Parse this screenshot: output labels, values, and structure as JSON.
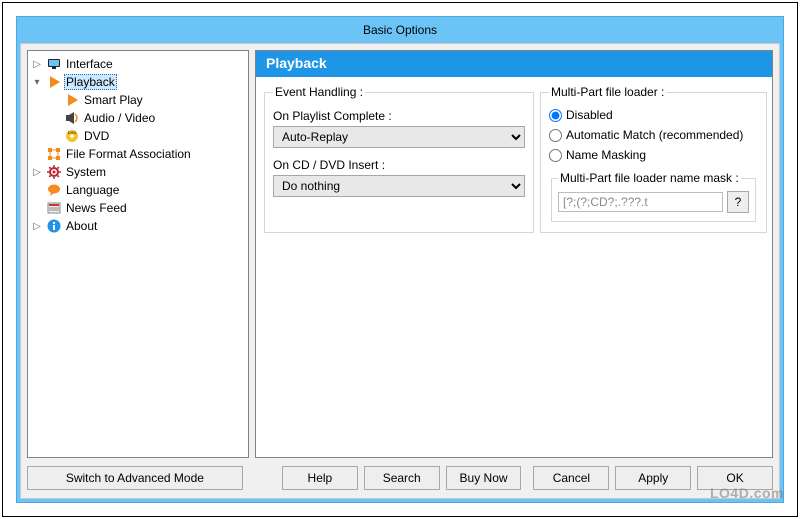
{
  "title": "Basic Options",
  "tree": {
    "items": [
      {
        "label": "Interface",
        "icon": "monitor",
        "depth": 0,
        "expander": "▷",
        "selected": false
      },
      {
        "label": "Playback",
        "icon": "play",
        "depth": 0,
        "expander": "▾",
        "selected": true
      },
      {
        "label": "Smart Play",
        "icon": "play",
        "depth": 1,
        "expander": "",
        "selected": false
      },
      {
        "label": "Audio / Video",
        "icon": "audio",
        "depth": 1,
        "expander": "",
        "selected": false
      },
      {
        "label": "DVD",
        "icon": "disc",
        "depth": 1,
        "expander": "",
        "selected": false
      },
      {
        "label": "File Format Association",
        "icon": "grid",
        "depth": 0,
        "expander": "",
        "selected": false
      },
      {
        "label": "System",
        "icon": "gear",
        "depth": 0,
        "expander": "▷",
        "selected": false
      },
      {
        "label": "Language",
        "icon": "bubble",
        "depth": 0,
        "expander": "",
        "selected": false
      },
      {
        "label": "News Feed",
        "icon": "news",
        "depth": 0,
        "expander": "",
        "selected": false
      },
      {
        "label": "About",
        "icon": "info",
        "depth": 0,
        "expander": "▷",
        "selected": false
      }
    ]
  },
  "panel": {
    "title": "Playback",
    "event_handling": {
      "legend": "Event Handling :",
      "playlist_complete_label": "On Playlist Complete :",
      "playlist_complete_value": "Auto-Replay",
      "cd_insert_label": "On CD / DVD Insert :",
      "cd_insert_value": "Do nothing"
    },
    "multipart": {
      "legend": "Multi-Part file loader :",
      "options": [
        {
          "label": "Disabled",
          "checked": true
        },
        {
          "label": "Automatic Match (recommended)",
          "checked": false
        },
        {
          "label": "Name Masking",
          "checked": false
        }
      ],
      "mask_legend": "Multi-Part file loader name mask :",
      "mask_value": "[?;(?;CD?;.???.t",
      "mask_help": "?"
    }
  },
  "buttons": {
    "switch": "Switch to Advanced Mode",
    "help": "Help",
    "search": "Search",
    "buynow": "Buy Now",
    "cancel": "Cancel",
    "apply": "Apply",
    "ok": "OK"
  },
  "watermark": "LO4D.com"
}
